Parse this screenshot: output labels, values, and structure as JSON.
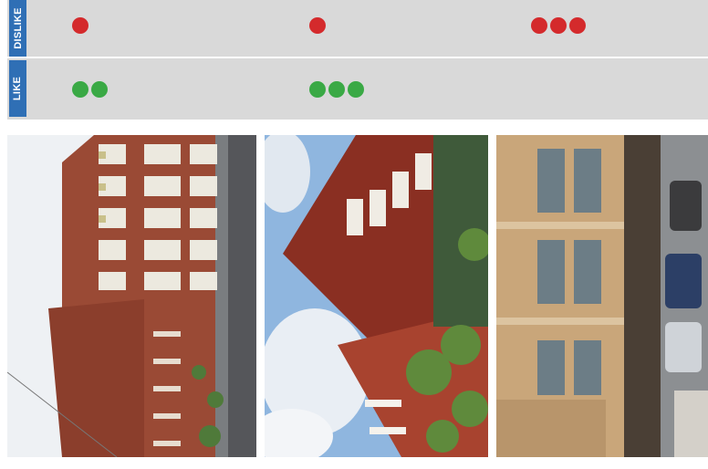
{
  "rows": {
    "dislike": {
      "label": "DISLIKE",
      "counts": [
        1,
        1,
        3
      ]
    },
    "like": {
      "label": "LIKE",
      "counts": [
        2,
        3,
        0
      ]
    }
  },
  "colors": {
    "dislike_dot": "#d42a2c",
    "like_dot": "#3aa945",
    "label_bar": "#2f6fb5",
    "row_bg": "#d9d9d9"
  },
  "photos": [
    {
      "subject": "brick-apartment-building-rotated"
    },
    {
      "subject": "brick-townhouses-with-trees-rotated"
    },
    {
      "subject": "tan-mixed-use-building-street-rotated"
    }
  ]
}
